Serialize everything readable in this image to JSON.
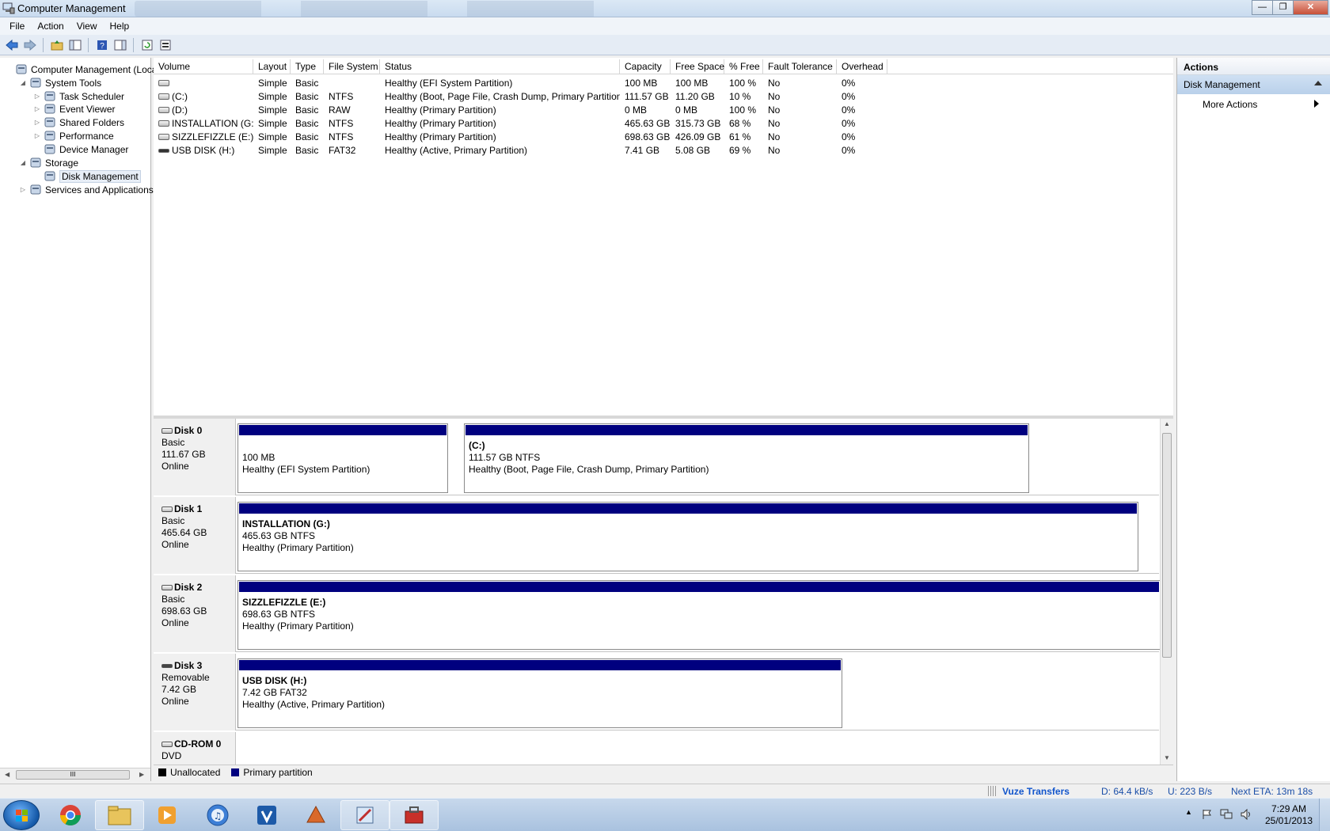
{
  "window": {
    "title": "Computer Management",
    "min_glyph": "—",
    "max_glyph": "❐",
    "close_glyph": "✕"
  },
  "menu": [
    "File",
    "Action",
    "View",
    "Help"
  ],
  "toolbar": {
    "icons": [
      "back-arrow-icon",
      "forward-arrow-icon",
      "up-folder-icon",
      "show-hide-tree-icon",
      "help-icon",
      "show-hide-action-pane-icon",
      "refresh-icon",
      "properties-icon"
    ]
  },
  "tree": {
    "items": [
      {
        "label": "Computer Management (Local",
        "expander": "",
        "icon": "computer-management-icon",
        "indent": 0
      },
      {
        "label": "System Tools",
        "expander": "◢",
        "icon": "system-tools-icon",
        "indent": 1
      },
      {
        "label": "Task Scheduler",
        "expander": "▷",
        "icon": "task-scheduler-icon",
        "indent": 2
      },
      {
        "label": "Event Viewer",
        "expander": "▷",
        "icon": "event-viewer-icon",
        "indent": 2
      },
      {
        "label": "Shared Folders",
        "expander": "▷",
        "icon": "shared-folders-icon",
        "indent": 2
      },
      {
        "label": "Performance",
        "expander": "▷",
        "icon": "performance-icon",
        "indent": 2
      },
      {
        "label": "Device Manager",
        "expander": "",
        "icon": "device-manager-icon",
        "indent": 2
      },
      {
        "label": "Storage",
        "expander": "◢",
        "icon": "storage-icon",
        "indent": 1
      },
      {
        "label": "Disk Management",
        "expander": "",
        "icon": "disk-management-icon",
        "indent": 2,
        "selected": true
      },
      {
        "label": "Services and Applications",
        "expander": "▷",
        "icon": "services-icon",
        "indent": 1
      }
    ],
    "scroll_left": "◀",
    "scroll_right": "▶",
    "scroll_grip": "III"
  },
  "volume_table": {
    "columns": [
      "Volume",
      "Layout",
      "Type",
      "File System",
      "Status",
      "Capacity",
      "Free Space",
      "% Free",
      "Fault Tolerance",
      "Overhead"
    ],
    "rows": [
      [
        "",
        "Simple",
        "Basic",
        "",
        "Healthy (EFI System Partition)",
        "100 MB",
        "100 MB",
        "100 %",
        "No",
        "0%"
      ],
      [
        "(C:)",
        "Simple",
        "Basic",
        "NTFS",
        "Healthy (Boot, Page File, Crash Dump, Primary Partition)",
        "111.57 GB",
        "11.20 GB",
        "10 %",
        "No",
        "0%"
      ],
      [
        "(D:)",
        "Simple",
        "Basic",
        "RAW",
        "Healthy (Primary Partition)",
        "0 MB",
        "0 MB",
        "100 %",
        "No",
        "0%"
      ],
      [
        "INSTALLATION (G:)",
        "Simple",
        "Basic",
        "NTFS",
        "Healthy (Primary Partition)",
        "465.63 GB",
        "315.73 GB",
        "68 %",
        "No",
        "0%"
      ],
      [
        "SIZZLEFIZZLE (E:)",
        "Simple",
        "Basic",
        "NTFS",
        "Healthy (Primary Partition)",
        "698.63 GB",
        "426.09 GB",
        "61 %",
        "No",
        "0%"
      ],
      [
        "USB DISK (H:)",
        "Simple",
        "Basic",
        "FAT32",
        "Healthy (Active, Primary Partition)",
        "7.41 GB",
        "5.08 GB",
        "69 %",
        "No",
        "0%"
      ]
    ]
  },
  "disks": [
    {
      "name": "Disk 0",
      "type": "Basic",
      "size": "111.67 GB",
      "status": "Online",
      "removable": false,
      "partitions": [
        {
          "name": "",
          "size": "100 MB",
          "status": "Healthy (EFI System Partition)"
        },
        {
          "name": "(C:)",
          "size": "111.57 GB NTFS",
          "status": "Healthy (Boot, Page File, Crash Dump, Primary Partition)"
        }
      ]
    },
    {
      "name": "Disk 1",
      "type": "Basic",
      "size": "465.64 GB",
      "status": "Online",
      "removable": false,
      "partitions": [
        {
          "name": "INSTALLATION  (G:)",
          "size": "465.63 GB NTFS",
          "status": "Healthy (Primary Partition)"
        }
      ]
    },
    {
      "name": "Disk 2",
      "type": "Basic",
      "size": "698.63 GB",
      "status": "Online",
      "removable": false,
      "partitions": [
        {
          "name": "SIZZLEFIZZLE  (E:)",
          "size": "698.63 GB NTFS",
          "status": "Healthy (Primary Partition)"
        }
      ]
    },
    {
      "name": "Disk 3",
      "type": "Removable",
      "size": "7.42 GB",
      "status": "Online",
      "removable": true,
      "partitions": [
        {
          "name": "USB DISK  (H:)",
          "size": "7.42 GB FAT32",
          "status": "Healthy (Active, Primary Partition)"
        }
      ]
    },
    {
      "name": "CD-ROM 0",
      "type": "DVD",
      "size": "",
      "status": "",
      "removable": false,
      "partitions": []
    }
  ],
  "legend": [
    {
      "label": "Unallocated",
      "color": "#000000"
    },
    {
      "label": "Primary partition",
      "color": "#00007f"
    }
  ],
  "actions": {
    "title": "Actions",
    "section": "Disk Management",
    "item": "More Actions"
  },
  "statusbar": {
    "vuze": "Vuze Transfers",
    "download": "D: 64.4 kB/s",
    "upload": "U: 223 B/s",
    "eta": "Next ETA: 13m 18s"
  },
  "taskbar": {
    "apps": [
      "chrome-icon",
      "file-explorer-icon",
      "media-player-icon",
      "itunes-icon",
      "vuze-icon",
      "game-icon",
      "paint-icon",
      "computer-management-toolbox-icon"
    ],
    "clock_time": "7:29 AM",
    "clock_date": "25/01/2013",
    "tray_arrow": "▲"
  },
  "colors": {
    "partition_bar": "#00007f",
    "accent": "#1155cc"
  }
}
